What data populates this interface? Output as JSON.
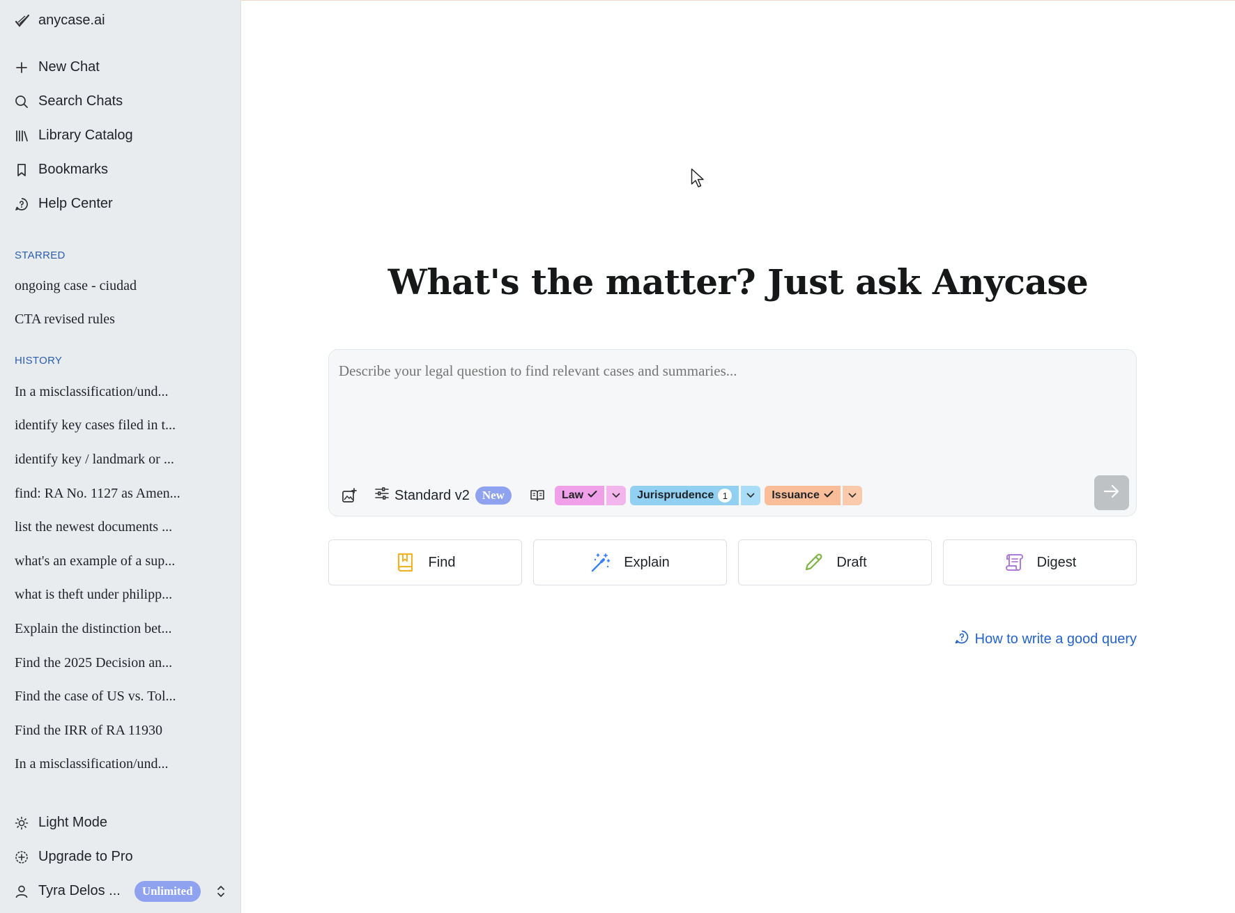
{
  "sidebar": {
    "brand": {
      "name": "anycase.ai",
      "icon": "feather-check-icon"
    },
    "nav": [
      {
        "label": "New Chat",
        "icon": "plus-icon"
      },
      {
        "label": "Search Chats",
        "icon": "search-icon"
      },
      {
        "label": "Library Catalog",
        "icon": "library-icon"
      },
      {
        "label": "Bookmarks",
        "icon": "bookmark-icon"
      },
      {
        "label": "Help Center",
        "icon": "help-circle-icon"
      }
    ],
    "starred_title": "STARRED",
    "starred": [
      "ongoing case - ciudad",
      "CTA revised rules"
    ],
    "history_title": "HISTORY",
    "history": [
      "In a misclassification/und...",
      "identify key cases filed in t...",
      "identify key / landmark or ...",
      "find: RA No. 1127 as Amen...",
      "list the newest documents ...",
      "what's an example of a sup...",
      "what is theft under philipp...",
      "Explain the distinction bet...",
      "Find the 2025 Decision an...",
      "Find the case of US vs. Tol...",
      "Find the IRR of RA 11930",
      "In a misclassification/und..."
    ],
    "bottom": {
      "theme_label": "Light Mode",
      "upgrade_label": "Upgrade to Pro",
      "user_name": "Tyra Delos ...",
      "plan_badge": "Unlimited"
    }
  },
  "main": {
    "headline": "What's the matter? Just ask Anycase",
    "composer": {
      "placeholder": "Describe your legal question to find relevant cases and summaries...",
      "model_label": "Standard v2",
      "model_badge": "New",
      "chips": [
        {
          "label": "Law",
          "color": "#f0a0e8",
          "arrow_color": "#f3b6ec"
        },
        {
          "label": "Jurisprudence",
          "count": "1",
          "color": "#92d0f2",
          "arrow_color": "#a9dcf6"
        },
        {
          "label": "Issuance",
          "color": "#f9bd99",
          "arrow_color": "#fbcaac"
        }
      ]
    },
    "actions": [
      {
        "label": "Find",
        "icon": "book-bookmark-icon",
        "color": "#f0b429"
      },
      {
        "label": "Explain",
        "icon": "magic-wand-icon",
        "color": "#3b82f6"
      },
      {
        "label": "Draft",
        "icon": "pencil-icon",
        "color": "#7cb342"
      },
      {
        "label": "Digest",
        "icon": "scroll-icon",
        "color": "#b07ad8"
      }
    ],
    "help_link": "How to write a good query"
  }
}
